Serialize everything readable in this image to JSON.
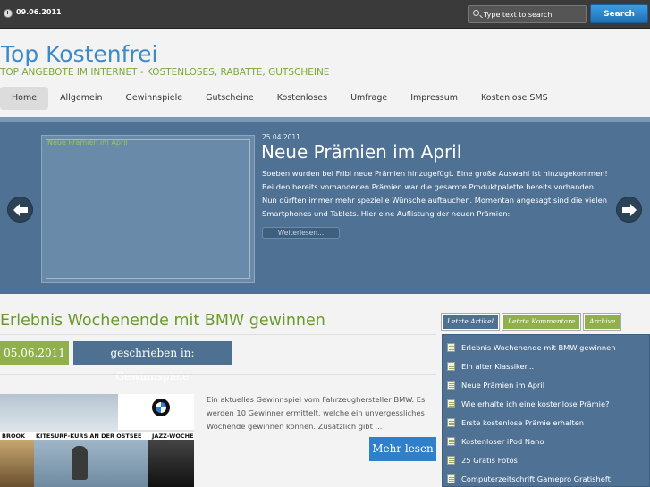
{
  "topbar": {
    "date": "09.06.2011",
    "search_placeholder": "Type text to search",
    "search_button": "Search"
  },
  "header": {
    "title": "Top Kostenfrei",
    "tagline": "TOP ANGEBOTE IM INTERNET - KOSTENLOSES, RABATTE, GUTSCHEINE"
  },
  "nav": {
    "items": [
      {
        "label": "Home"
      },
      {
        "label": "Allgemein"
      },
      {
        "label": "Gewinnspiele"
      },
      {
        "label": "Gutscheine"
      },
      {
        "label": "Kostenloses"
      },
      {
        "label": "Umfrage"
      },
      {
        "label": "Impressum"
      },
      {
        "label": "Kostenlose SMS"
      }
    ],
    "active": "Home"
  },
  "slider": {
    "image_alt": "Neue Prämien im April",
    "date": "25.04.2011",
    "title": "Neue Prämien im April",
    "text": "Soeben wurden bei Fribi neue Prämien hinzugefügt. Eine große Auswahl ist hinzugekommen! Bei den bereits vorhandenen Prämien war die gesamte Produktpalette bereits vorhanden. Nun dürften immer mehr spezielle Wünsche auftauchen. Momentan angesagt sind die vielen Smartphones und Tablets. Hier eine Auflistung der neuen Prämien:",
    "more_label": "Weiterlesen..."
  },
  "post": {
    "title": "Erlebnis Wochenende mit BMW gewinnen",
    "date": "05.06.2011",
    "category": "geschrieben in: Gewinnspiele",
    "excerpt": "Ein aktuelles Gewinnspiel vom Fahrzeughersteller BMW. Es werden 10 Gewinner ermittelt, welche ein unvergessliches Wochende gewinnen können. Zusätzlich gibt ...",
    "read_more": "Mehr lesen",
    "thumb_captions": [
      "BROOK",
      "KITESURF-KURS AN DER OSTSEE",
      "JAZZ-WOCHE"
    ]
  },
  "sidebar": {
    "tabs": [
      {
        "label": "Letzte Artikel"
      },
      {
        "label": "Letzte Kommentare"
      },
      {
        "label": "Archive"
      }
    ],
    "items": [
      {
        "label": "Erlebnis Wochenende mit BMW gewinnen"
      },
      {
        "label": "Ein alter Klassiker..."
      },
      {
        "label": "Neue Prämien im April"
      },
      {
        "label": "Wie erhalte ich eine kostenlose Prämie?"
      },
      {
        "label": "Erste kostenlose Prämie erhalten"
      },
      {
        "label": "Kostenloser iPod Nano"
      },
      {
        "label": "25 Gratis Fotos"
      },
      {
        "label": "Computerzeitschrift Gamepro Gratisheft"
      }
    ]
  },
  "colors": {
    "title_blue": "#3a8ac9",
    "accent_green": "#8fb04a",
    "slider_blue": "#4e7194",
    "topbar": "#3a3a3a",
    "search_button": "#2f7fc9"
  }
}
